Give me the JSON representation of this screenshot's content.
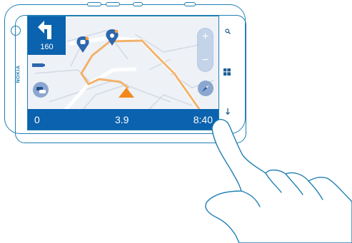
{
  "device": {
    "brand": "NOKIA"
  },
  "navigation": {
    "turn_distance": "160",
    "bottom_bar": {
      "left_value": "0",
      "middle_value": "3.9",
      "right_value": "8:40"
    }
  },
  "icons": {
    "turn": "turn-left-arrow-icon",
    "zoom_in": "plus-icon",
    "zoom_out": "minus-icon",
    "compass": "compass-icon",
    "traffic": "traffic-icon",
    "search": "search-icon",
    "start": "windows-icon",
    "back": "back-arrow-icon"
  },
  "labels": {
    "zoom_in": "+",
    "zoom_out": "−"
  },
  "colors": {
    "primary_blue": "#0b62ae",
    "route_orange": "#f2a04a",
    "position_arrow": "#f28a1a"
  }
}
